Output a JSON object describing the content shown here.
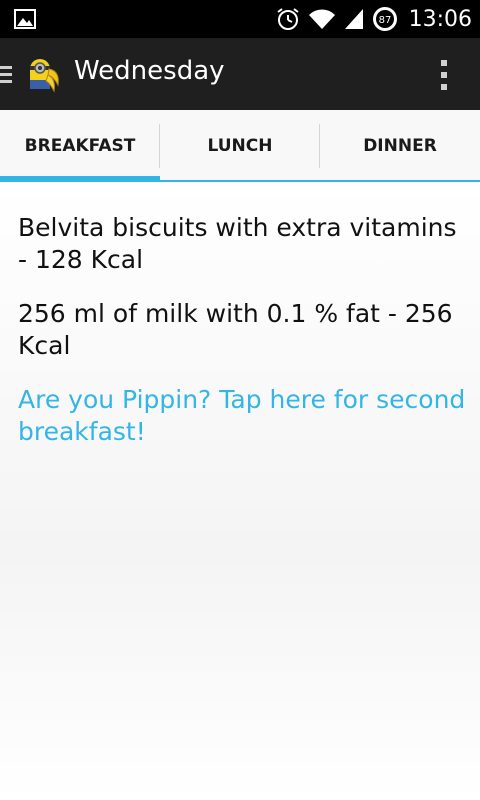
{
  "status_bar": {
    "notification_icon": "image-icon",
    "alarm_icon": "alarm-clock-icon",
    "wifi_icon": "wifi-icon",
    "signal_icon": "cell-signal-icon",
    "battery_level": "87",
    "time": "13:06"
  },
  "action_bar": {
    "title": "Wednesday",
    "drawer_icon": "hamburger-menu-icon",
    "logo_icon": "minion-logo-icon",
    "overflow_icon": "more-vertical-icon"
  },
  "tabs": [
    {
      "label": "BREAKFAST",
      "active": true
    },
    {
      "label": "LUNCH",
      "active": false
    },
    {
      "label": "DINNER",
      "active": false
    }
  ],
  "meals": [
    {
      "text": "Belvita biscuits with extra vitamins - 128 Kcal"
    },
    {
      "text": "256 ml of milk with 0.1 % fat - 256 Kcal"
    }
  ],
  "second_breakfast_link": "Are you Pippin? Tap here for second breakfast!",
  "colors": {
    "accent": "#33b5e5",
    "action_bar": "#1f1f1f",
    "status_bar": "#000000"
  }
}
